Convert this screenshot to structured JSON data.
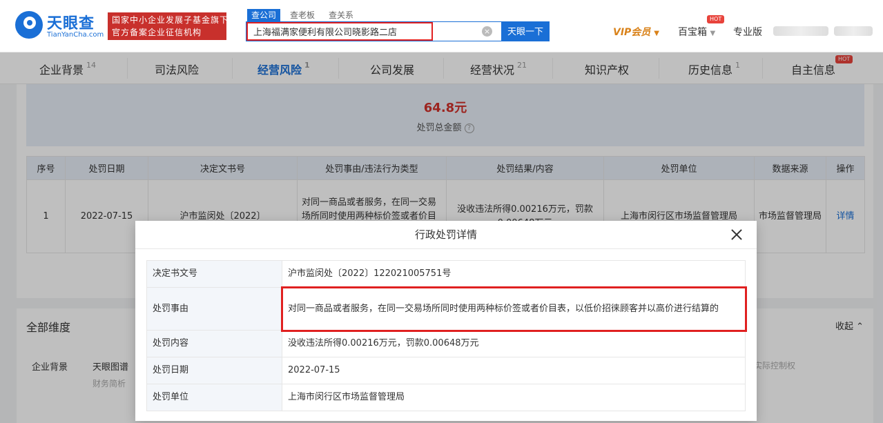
{
  "header": {
    "logo_cn": "天眼查",
    "logo_en": "TianYanCha.com",
    "slogan_line1": "国家中小企业发展子基金旗下",
    "slogan_line2": "官方备案企业征信机构",
    "search_tabs": [
      "查公司",
      "查老板",
      "查关系"
    ],
    "search_value": "上海福满家便利有限公司晓影路二店",
    "search_button": "天眼一下",
    "vip": "VIP会员",
    "baibao": "百宝箱",
    "pro": "专业版",
    "hot": "HOT"
  },
  "tabs": [
    {
      "label": "企业背景",
      "count": "14"
    },
    {
      "label": "司法风险",
      "count": ""
    },
    {
      "label": "经营风险",
      "count": "1"
    },
    {
      "label": "公司发展",
      "count": ""
    },
    {
      "label": "经营状况",
      "count": "21"
    },
    {
      "label": "知识产权",
      "count": ""
    },
    {
      "label": "历史信息",
      "count": "1"
    },
    {
      "label": "自主信息",
      "count": ""
    }
  ],
  "summary": {
    "amount": "64.8元",
    "label": "处罚总金额",
    "help": "?"
  },
  "table": {
    "headers": [
      "序号",
      "处罚日期",
      "决定文书号",
      "处罚事由/违法行为类型",
      "处罚结果/内容",
      "处罚单位",
      "数据来源",
      "操作"
    ],
    "row": {
      "index": "1",
      "date": "2022-07-15",
      "doc_no": "沪市监闵处〔2022〕",
      "reason": "对同一商品或者服务，在同一交易场所同时使用两种标价签或者价目表，以低价招徕顾客并以高价",
      "result": "没收违法所得0.00216万元，罚款0.00648万元",
      "unit": "上海市闵行区市场监督管理局",
      "source": "市场监督管理局",
      "action": "详情"
    }
  },
  "lower": {
    "title": "全部维度",
    "collapse": "收起",
    "item1": "企业背景",
    "item2": "天眼图谱",
    "item3": "财务简析",
    "item4": "实际控制权"
  },
  "modal": {
    "title": "行政处罚详情",
    "rows": [
      {
        "k": "决定书文号",
        "v": "沪市监闵处〔2022〕122021005751号"
      },
      {
        "k": "处罚事由",
        "v": "对同一商品或者服务，在同一交易场所同时使用两种标价签或者价目表，以低价招徕顾客并以高价进行结算的"
      },
      {
        "k": "处罚内容",
        "v": "没收违法所得0.00216万元，罚款0.00648万元"
      },
      {
        "k": "处罚日期",
        "v": "2022-07-15"
      },
      {
        "k": "处罚单位",
        "v": "上海市闵行区市场监督管理局"
      }
    ]
  }
}
